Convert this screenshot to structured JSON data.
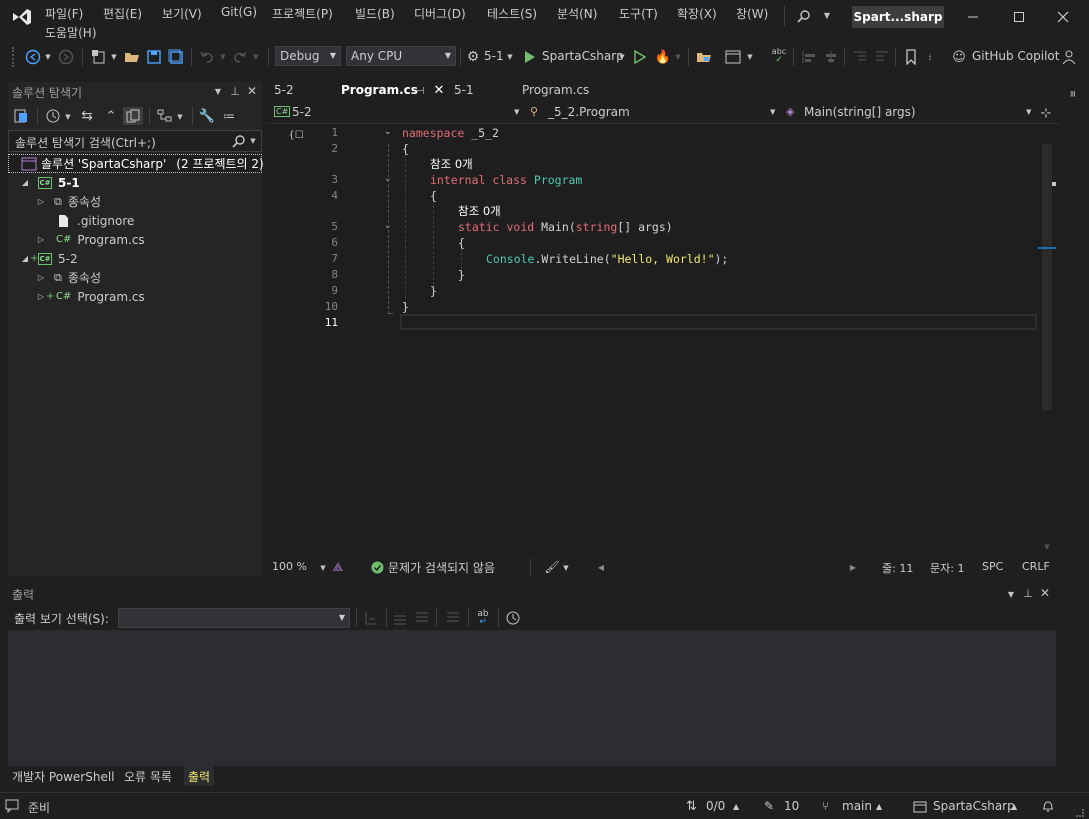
{
  "menu": {
    "items": [
      "파일(F)",
      "편집(E)",
      "보기(V)",
      "Git(G)",
      "프로젝트(P)",
      "빌드(B)",
      "디버그(D)",
      "테스트(S)",
      "분석(N)",
      "도구(T)",
      "확장(X)",
      "창(W)"
    ],
    "help": "도움말(H)"
  },
  "window": {
    "title": "Spart...sharp"
  },
  "toolbar": {
    "config": "Debug",
    "platform": "Any CPU",
    "startup": "5-1",
    "run_target": "SpartaCsharp",
    "copilot": "GitHub Copilot"
  },
  "solution_explorer": {
    "title": "솔루션 탐색기",
    "search_placeholder": "솔루션 탐색기 검색(Ctrl+;)",
    "solution_label": "솔루션 'SpartaCsharp'",
    "solution_count": "(2 프로젝트의 2)",
    "tree": [
      {
        "label": "5-1"
      },
      {
        "label": "종속성"
      },
      {
        "label": ".gitignore"
      },
      {
        "label": "Program.cs"
      },
      {
        "label": "5-2"
      },
      {
        "label": "종속성"
      },
      {
        "label": "Program.cs"
      }
    ]
  },
  "editor": {
    "tabs": [
      {
        "label": "5-2"
      },
      {
        "label": "Program.cs"
      },
      {
        "label": "5-1"
      },
      {
        "label": "Program.cs"
      }
    ],
    "nav_project": "5-2",
    "nav_class": "_5_2.Program",
    "nav_member": "Main(string[] args)",
    "line_numbers": [
      "1",
      "2",
      "3",
      "4",
      "5",
      "6",
      "7",
      "8",
      "9",
      "10",
      "11"
    ],
    "ref_lens": "참조 0개",
    "code": {
      "l1_kw": "namespace",
      "l1_name": "_5_2",
      "open_brace": "{",
      "close_brace": "}",
      "l3_mod": "internal",
      "l3_kw": "class",
      "l3_name": "Program",
      "l5_static": "static",
      "l5_void": "void",
      "l5_name": "Main(",
      "l5_type": "string",
      "l5_rest": "[] args)",
      "l7_console": "Console",
      "l7_call": ".WriteLine(",
      "l7_str": "\"Hello, World!\"",
      "l7_end": ");"
    },
    "zoom": "100 %",
    "issues": "문제가 검색되지 않음",
    "line_info": "줄: 11",
    "char_info": "문자: 1",
    "spacing": "SPC",
    "eol": "CRLF"
  },
  "output": {
    "title": "출력",
    "source_label": "출력 보기 선택(S):",
    "source_value": ""
  },
  "bottom_tabs": [
    "개발자 PowerShell",
    "오류 목록",
    "출력"
  ],
  "status_bar": {
    "ready": "준비",
    "changes": "0/0",
    "edits": "10",
    "branch": "main",
    "repo": "SpartaCsharp"
  },
  "colors": {
    "accent": "#0e639c",
    "status_ok": "#6fbf6f"
  }
}
